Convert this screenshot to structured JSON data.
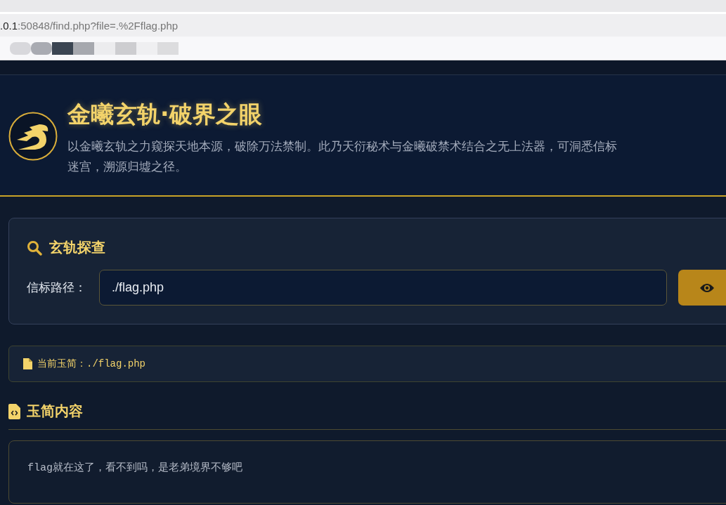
{
  "browser": {
    "address_host": ".0.1",
    "address_rest": ":50848/find.php?file=.%2Fflag.php"
  },
  "header": {
    "title": "金曦玄轨·破界之眼",
    "description": "以金曦玄轨之力窥探天地本源，破除万法禁制。此乃天衍秘术与金曦破禁术结合之无上法器，可洞悉信标迷宫，溯源归墟之径。"
  },
  "search_card": {
    "title": "玄轨探查",
    "label": "信标路径：",
    "value": "./flag.php"
  },
  "current_file": {
    "label": "当前玉简：",
    "path": "./flag.php"
  },
  "content": {
    "heading": "玉简内容",
    "text_mono": "flag",
    "text": "就在这了，看不到吗，是老弟境界不够吧"
  }
}
